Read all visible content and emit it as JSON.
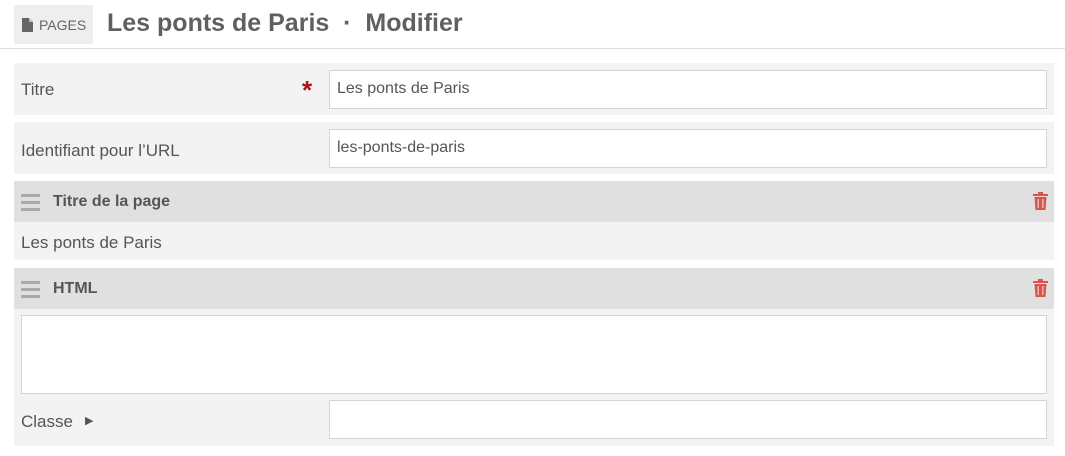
{
  "header": {
    "breadcrumb": "PAGES",
    "title": "Les ponts de Paris  ·  Modifier"
  },
  "fields": {
    "titre_label": "Titre",
    "titre_value": "Les ponts de Paris",
    "slug_label": "Identifiant pour l’URL",
    "slug_value": "les-ponts-de-paris"
  },
  "blocks": [
    {
      "title": "Titre de la page",
      "content": "Les ponts de Paris"
    },
    {
      "title": "HTML",
      "html_value": "",
      "class_label": "Classe",
      "class_value": ""
    }
  ],
  "colors": {
    "required": "#b01010",
    "delete": "#d9534f"
  }
}
